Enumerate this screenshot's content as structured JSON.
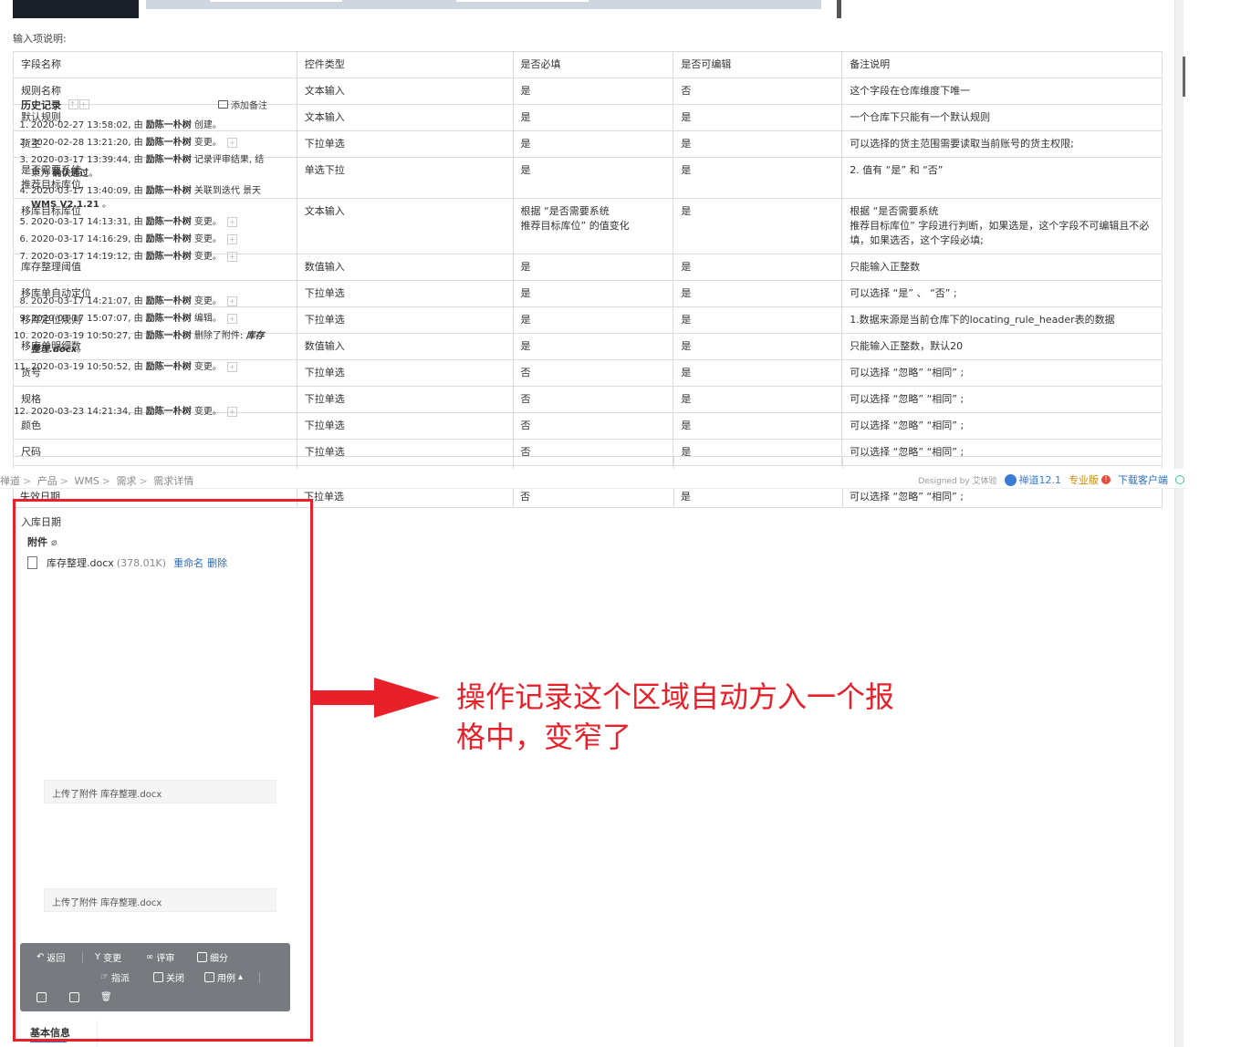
{
  "section_label": "输入项说明:",
  "table": {
    "headers": [
      "字段名称",
      "控件类型",
      "是否必填",
      "是否可编辑",
      "备注说明"
    ],
    "rows": [
      [
        "规则名称",
        "文本输入",
        "是",
        "否",
        "这个字段在仓库维度下唯一"
      ],
      [
        "默认规则",
        "文本输入",
        "是",
        "是",
        "一个仓库下只能有一个默认规则"
      ],
      [
        "货主",
        "下拉单选",
        "是",
        "是",
        "可以选择的货主范围需要读取当前账号的货主权限;"
      ],
      [
        "是否需要系统\n推荐目标库位",
        "单选下拉",
        "是",
        "是",
        "2. 值有 “是” 和 “否”"
      ],
      [
        "移库目标库位",
        "文本输入",
        "根据 “是否需要系统\n推荐目标库位” 的值变化",
        "是",
        "根据 “是否需要系统\n推荐目标库位” 字段进行判断，如果选是，这个字段不可编辑且不必\n填，如果选否，这个字段必填;"
      ],
      [
        "库存整理阈值",
        "数值输入",
        "是",
        "是",
        "只能输入正整数"
      ],
      [
        "移库单自动定位",
        "下拉单选",
        "是",
        "是",
        "可以选择 “是” 、 “否” ;"
      ],
      [
        "移库定位规则",
        "下拉单选",
        "是",
        "是",
        "1.数据来源是当前仓库下的locating_rule_header表的数据"
      ],
      [
        "移库单明细数",
        "数值输入",
        "是",
        "是",
        "只能输入正整数，默认20"
      ],
      [
        "货号",
        "下拉单选",
        "否",
        "是",
        "可以选择 “忽略”  “相同” ;"
      ],
      [
        "规格",
        "下拉单选",
        "否",
        "是",
        "可以选择 “忽略”  “相同” ;"
      ],
      [
        "颜色",
        "下拉单选",
        "否",
        "是",
        "可以选择 “忽略”  “相同” ;"
      ],
      [
        "尺码",
        "下拉单选",
        "否",
        "是",
        "可以选择 “忽略”  “相同” ;"
      ]
    ],
    "partial_row": [
      "失效日期",
      "下拉单选",
      "否",
      "是",
      "可以选择 “忽略”  “相同” ;"
    ]
  },
  "breadcrumb": [
    "禅道",
    "产品",
    "WMS",
    "需求",
    "需求详情"
  ],
  "footer": {
    "designed": "Designed by 艾体验",
    "version": "禅道12.1",
    "edition": "专业版",
    "download": "下载客户端"
  },
  "panel": {
    "field_label": "入库日期",
    "attachments_title": "附件",
    "file_name": "库存整理.docx",
    "file_size": "(378.01K)",
    "rename": "重命名",
    "delete": "删除",
    "history_title": "历史记录",
    "add_note": "添加备注",
    "history": [
      {
        "num": "1.",
        "time": "2020-02-27 13:58:02, 由 ",
        "user": "励陈一朴树",
        "action": " 创建。",
        "plus": false
      },
      {
        "num": "2.",
        "time": "2020-02-28 13:21:20, 由 ",
        "user": "励陈一朴树",
        "action": " 变更。",
        "plus": true
      },
      {
        "num": "3.",
        "time": "2020-03-17 13:39:44, 由 ",
        "user": "励陈一朴树",
        "action": " 记录评审结果, 结果为 ",
        "extra": "确认通过",
        "tail": "。",
        "plus": false
      },
      {
        "num": "4.",
        "time": "2020-03-17 13:40:09, 由 ",
        "user": "励陈一朴树",
        "action": " 关联到迭代 景天 ",
        "extra": "WMS V2.1.21",
        "tail": " 。",
        "plus": false
      },
      {
        "num": "5.",
        "time": "2020-03-17 14:13:31, 由 ",
        "user": "励陈一朴树",
        "action": " 变更。",
        "plus": true
      },
      {
        "num": "6.",
        "time": "2020-03-17 14:16:29, 由 ",
        "user": "励陈一朴树",
        "action": " 变更。",
        "plus": true
      },
      {
        "num": "7.",
        "time": "2020-03-17 14:19:12, 由 ",
        "user": "励陈一朴树",
        "action": " 变更。",
        "plus": true
      },
      {
        "num": "8.",
        "time": "2020-03-17 14:21:07, 由 ",
        "user": "励陈一朴树",
        "action": " 变更。",
        "plus": true
      },
      {
        "num": "9.",
        "time": "2020-03-17 15:07:07, 由 ",
        "user": "励陈一朴树",
        "action": " 编辑。",
        "plus": true
      },
      {
        "num": "10.",
        "time": "2020-03-19 10:50:27, 由 ",
        "user": "励陈一朴树",
        "action": " 删除了附件: ",
        "italic": "库存整理.docx",
        "tail": "。",
        "plus": false
      },
      {
        "num": "11.",
        "time": "2020-03-19 10:50:52, 由 ",
        "user": "励陈一朴树",
        "action": " 变更。",
        "plus": true
      },
      {
        "num": "12.",
        "time": "2020-03-23 14:21:34, 由 ",
        "user": "励陈一朴树",
        "action": " 变更。",
        "plus": true
      }
    ],
    "change_box_1": "上传了附件 库存整理.docx",
    "change_box_2": "上传了附件 库存整理.docx",
    "toolbar": {
      "back": "返回",
      "change": "变更",
      "review": "评审",
      "subdivide": "细分",
      "assign": "指派",
      "close": "关闭",
      "case": "用例"
    },
    "basic_info": "基本信息"
  },
  "annotation": "操作记录这个区域自动方入一个报格中，变窄了",
  "colors": {
    "annotation_red": "#e8202a",
    "link_blue": "#2a6ebb",
    "toolbar_gray": "#777b80"
  }
}
